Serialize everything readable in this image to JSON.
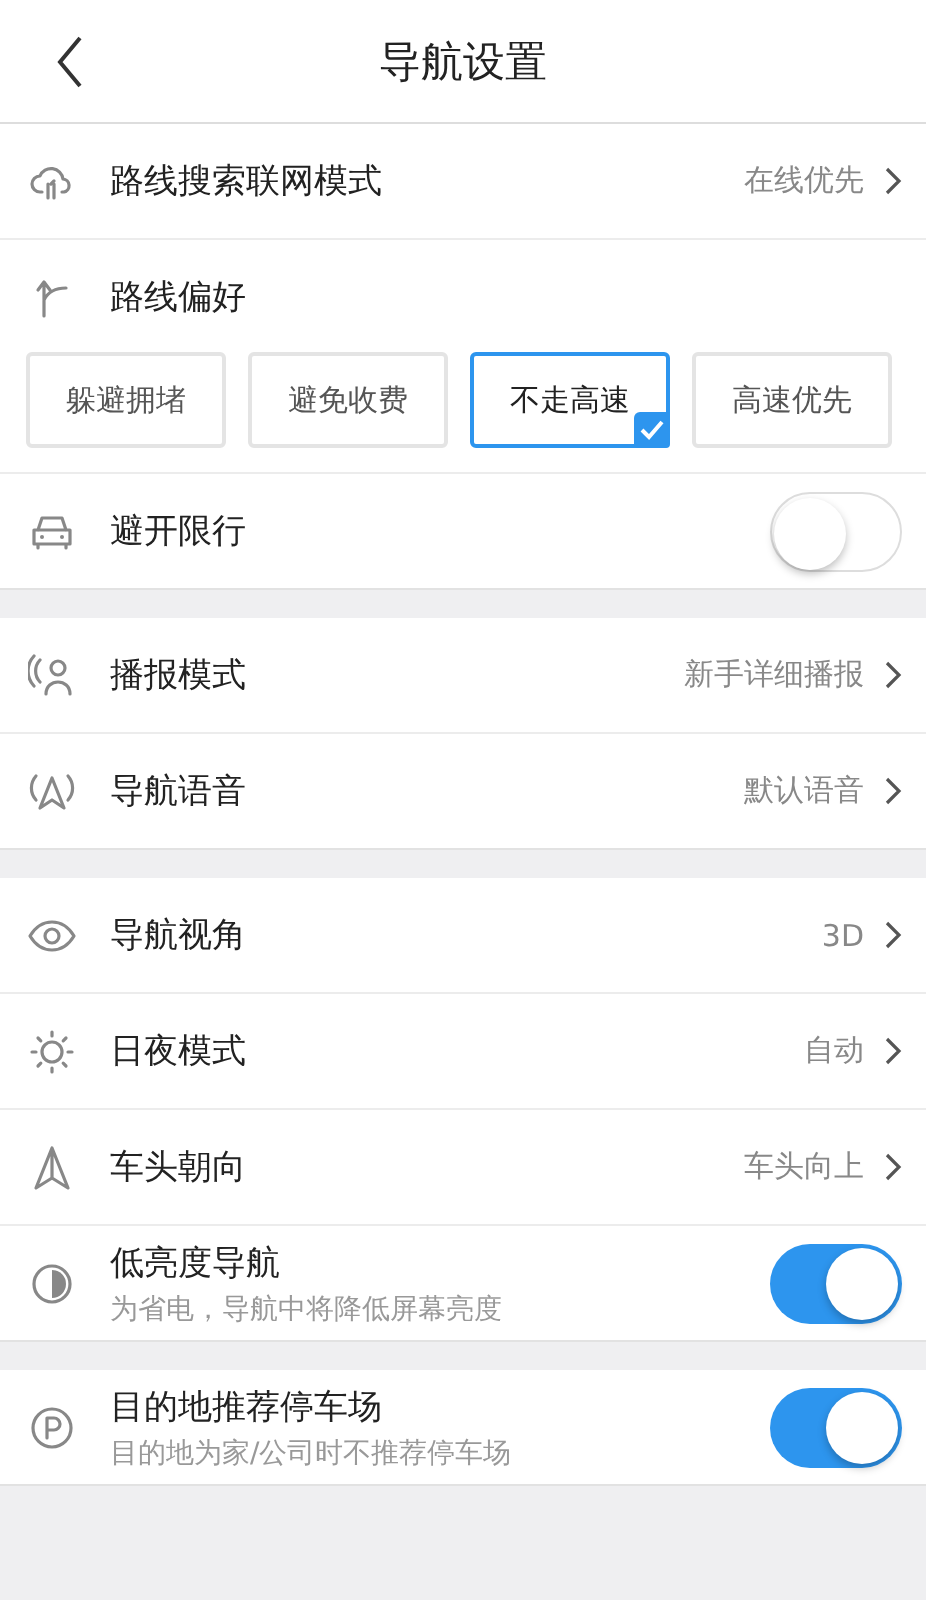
{
  "header": {
    "title": "导航设置"
  },
  "groups": [
    {
      "rows": [
        {
          "kind": "link",
          "label": "路线搜索联网模式",
          "value": "在线优先"
        },
        {
          "kind": "preference",
          "label": "路线偏好",
          "options": [
            {
              "label": "躲避拥堵",
              "selected": false
            },
            {
              "label": "避免收费",
              "selected": false
            },
            {
              "label": "不走高速",
              "selected": true
            },
            {
              "label": "高速优先",
              "selected": false
            }
          ]
        },
        {
          "kind": "toggle",
          "label": "避开限行",
          "on": false
        }
      ]
    },
    {
      "rows": [
        {
          "kind": "link",
          "label": "播报模式",
          "value": "新手详细播报"
        },
        {
          "kind": "link",
          "label": "导航语音",
          "value": "默认语音"
        }
      ]
    },
    {
      "rows": [
        {
          "kind": "link",
          "label": "导航视角",
          "value": "3D"
        },
        {
          "kind": "link",
          "label": "日夜模式",
          "value": "自动"
        },
        {
          "kind": "link",
          "label": "车头朝向",
          "value": "车头向上"
        },
        {
          "kind": "toggle",
          "label": "低亮度导航",
          "hint": "为省电，导航中将降低屏幕亮度",
          "on": true
        }
      ]
    },
    {
      "rows": [
        {
          "kind": "toggle",
          "label": "目的地推荐停车场",
          "hint": "目的地为家/公司时不推荐停车场",
          "on": true
        }
      ]
    }
  ]
}
